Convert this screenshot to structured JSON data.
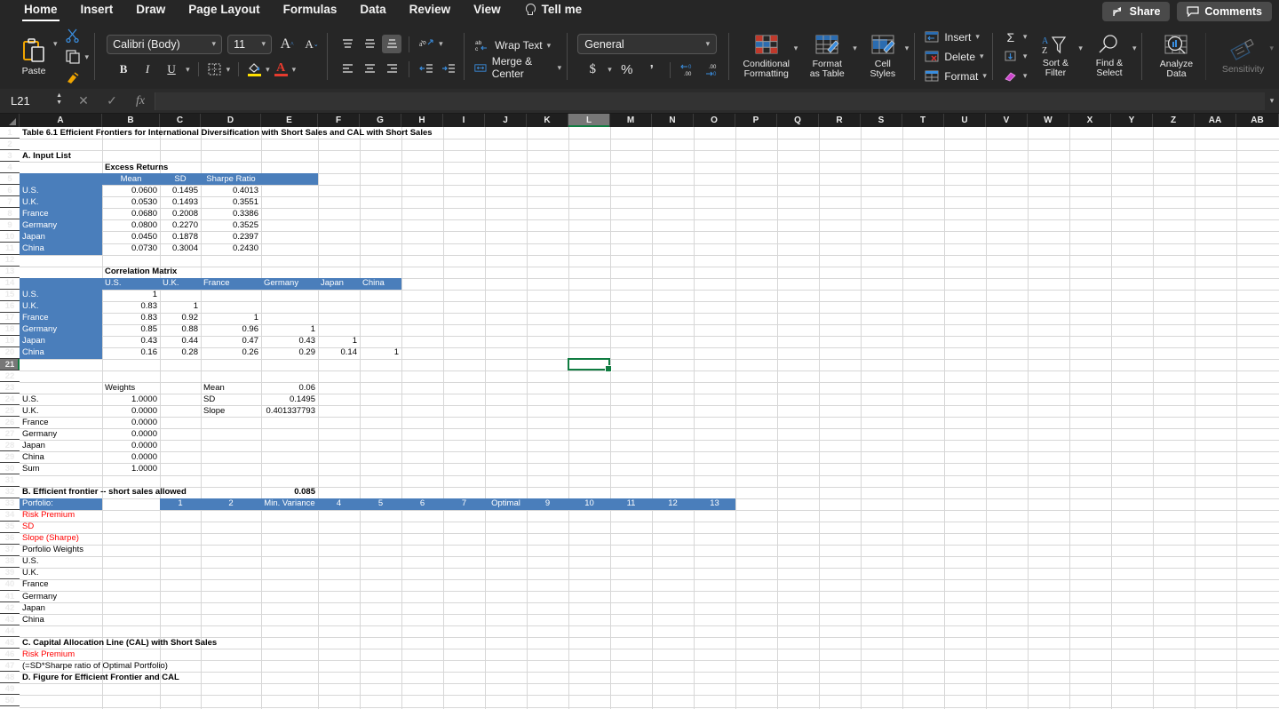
{
  "app": {
    "title": "Microsoft Excel"
  },
  "tabs": [
    {
      "label": "Home",
      "active": true
    },
    {
      "label": "Insert",
      "active": false
    },
    {
      "label": "Draw",
      "active": false
    },
    {
      "label": "Page Layout",
      "active": false
    },
    {
      "label": "Formulas",
      "active": false
    },
    {
      "label": "Data",
      "active": false
    },
    {
      "label": "Review",
      "active": false
    },
    {
      "label": "View",
      "active": false
    },
    {
      "label": "Tell me",
      "active": false,
      "icon": "lightbulb-icon"
    }
  ],
  "top_right": [
    {
      "label": "Share",
      "icon": "share-icon"
    },
    {
      "label": "Comments",
      "icon": "comment-icon"
    }
  ],
  "ribbon": {
    "clipboard": {
      "paste_label": "Paste",
      "cut_icon": "scissors-icon",
      "copy_icon": "copy-icon",
      "format_painter_icon": "format-painter-icon"
    },
    "font": {
      "font_name": "Calibri (Body)",
      "font_size": "11",
      "grow_font": "A^",
      "shrink_font": "Av",
      "bold": "B",
      "italic": "I",
      "underline": "U",
      "borders_icon": "borders-icon",
      "fill_color_icon": "fill-color-icon",
      "font_color_icon": "font-color-icon"
    },
    "alignment": {
      "align_top_icon": "align-top-icon",
      "align_middle_icon": "align-middle-icon",
      "align_bottom_icon": "align-bottom-icon",
      "orientation_icon": "orientation-icon",
      "align_left_icon": "align-left-icon",
      "align_center_icon": "align-center-icon",
      "align_right_icon": "align-right-icon",
      "decrease_indent_icon": "decrease-indent-icon",
      "increase_indent_icon": "increase-indent-icon",
      "wrap_text": "Wrap Text",
      "merge_center": "Merge & Center"
    },
    "number": {
      "format": "General",
      "currency": "$",
      "percent": "%",
      "comma": "‰",
      "decrease_decimal_icon": "decrease-decimal-icon",
      "increase_decimal_icon": "increase-decimal-icon"
    },
    "styles": {
      "conditional_formatting": "Conditional\nFormatting",
      "conditional_formatting_l1": "Conditional",
      "conditional_formatting_l2": "Formatting",
      "format_as_table_l1": "Format",
      "format_as_table_l2": "as Table",
      "cell_styles_l1": "Cell",
      "cell_styles_l2": "Styles"
    },
    "cells": {
      "insert": "Insert",
      "delete": "Delete",
      "format": "Format"
    },
    "editing": {
      "autosum_icon": "sigma-icon",
      "fill_icon": "fill-down-icon",
      "clear_icon": "eraser-icon",
      "sort_filter_l1": "Sort &",
      "sort_filter_l2": "Filter",
      "find_select_l1": "Find &",
      "find_select_l2": "Select"
    },
    "analysis": {
      "analyze_data_l1": "Analyze",
      "analyze_data_l2": "Data",
      "sensitivity": "Sensitivity"
    }
  },
  "formula_bar": {
    "name_box": "L21",
    "cancel_icon": "x-icon",
    "enter_icon": "check-icon",
    "function_icon": "fx-icon",
    "formula": ""
  },
  "grid": {
    "selected_cell": "L21",
    "selected_column": "L",
    "selected_row": 21,
    "columns": [
      "A",
      "B",
      "C",
      "D",
      "E",
      "F",
      "G",
      "H",
      "I",
      "J",
      "K",
      "L",
      "M",
      "N",
      "O",
      "P",
      "Q",
      "R",
      "S",
      "T",
      "U",
      "V",
      "W",
      "X",
      "Y",
      "Z",
      "AA",
      "AB"
    ],
    "header_fill_color": "#4a7ebb",
    "selection_color": "#107c41",
    "red_text_color": "#ff0000",
    "first_row": 1,
    "last_row": 50
  },
  "sheet": {
    "title": "Table 6.1 Efficient Frontiers for International Diversification with Short Sales and CAL with Short Sales",
    "section_a": "A. Input List",
    "excess_returns_label": "Excess Returns",
    "input_headers": [
      "Mean",
      "SD",
      "Sharpe Ratio"
    ],
    "input_rows": [
      {
        "name": "U.S.",
        "mean": "0.0600",
        "sd": "0.1495",
        "sharpe": "0.4013"
      },
      {
        "name": "U.K.",
        "mean": "0.0530",
        "sd": "0.1493",
        "sharpe": "0.3551"
      },
      {
        "name": "France",
        "mean": "0.0680",
        "sd": "0.2008",
        "sharpe": "0.3386"
      },
      {
        "name": "Germany",
        "mean": "0.0800",
        "sd": "0.2270",
        "sharpe": "0.3525"
      },
      {
        "name": "Japan",
        "mean": "0.0450",
        "sd": "0.1878",
        "sharpe": "0.2397"
      },
      {
        "name": "China",
        "mean": "0.0730",
        "sd": "0.3004",
        "sharpe": "0.2430"
      }
    ],
    "correlation_label": "Correlation Matrix",
    "correlation_headers": [
      "U.S.",
      "U.K.",
      "France",
      "Germany",
      "Japan",
      "China"
    ],
    "correlation_rows": [
      {
        "name": "U.S.",
        "values": [
          "1",
          "",
          "",
          "",
          "",
          ""
        ]
      },
      {
        "name": "U.K.",
        "values": [
          "0.83",
          "1",
          "",
          "",
          "",
          ""
        ]
      },
      {
        "name": "France",
        "values": [
          "0.83",
          "0.92",
          "1",
          "",
          "",
          ""
        ]
      },
      {
        "name": "Germany",
        "values": [
          "0.85",
          "0.88",
          "0.96",
          "1",
          "",
          ""
        ]
      },
      {
        "name": "Japan",
        "values": [
          "0.43",
          "0.44",
          "0.47",
          "0.43",
          "1",
          ""
        ]
      },
      {
        "name": "China",
        "values": [
          "0.16",
          "0.28",
          "0.26",
          "0.29",
          "0.14",
          "1"
        ]
      }
    ],
    "weights_label": "Weights",
    "weights_rows": [
      {
        "name": "U.S.",
        "w": "1.0000"
      },
      {
        "name": "U.K.",
        "w": "0.0000"
      },
      {
        "name": "France",
        "w": "0.0000"
      },
      {
        "name": "Germany",
        "w": "0.0000"
      },
      {
        "name": "Japan",
        "w": "0.0000"
      },
      {
        "name": "China",
        "w": "0.0000"
      },
      {
        "name": "Sum",
        "w": "1.0000"
      }
    ],
    "stats": [
      {
        "label": "Mean",
        "value": "0.06"
      },
      {
        "label": "SD",
        "value": "0.1495"
      },
      {
        "label": "Slope",
        "value": "0.401337793"
      }
    ],
    "section_b": "B. Efficient frontier -- short sales allowed",
    "section_b_value": "0.085",
    "portfolio_label": "Porfolio:",
    "portfolio_headers": [
      "1",
      "2",
      "Min. Variance",
      "4",
      "5",
      "6",
      "7",
      "Optimal",
      "9",
      "10",
      "11",
      "12",
      "13"
    ],
    "frontier_rows": [
      {
        "label": "Risk Premium",
        "red": true
      },
      {
        "label": "SD",
        "red": true
      },
      {
        "label": "Slope (Sharpe)",
        "red": true
      },
      {
        "label": "Porfolio Weights",
        "red": false
      },
      {
        "label": "U.S.",
        "red": false
      },
      {
        "label": "U.K.",
        "red": false
      },
      {
        "label": "France",
        "red": false
      },
      {
        "label": "Germany",
        "red": false
      },
      {
        "label": "Japan",
        "red": false
      },
      {
        "label": "China",
        "red": false
      }
    ],
    "section_c": "C. Capital Allocation Line (CAL) with Short Sales",
    "section_c_risk_premium": "Risk Premium",
    "section_c_note": "(=SD*Sharpe ratio of Optimal Portfolio)",
    "section_d": "D. Figure for Efficient Frontier and CAL"
  }
}
